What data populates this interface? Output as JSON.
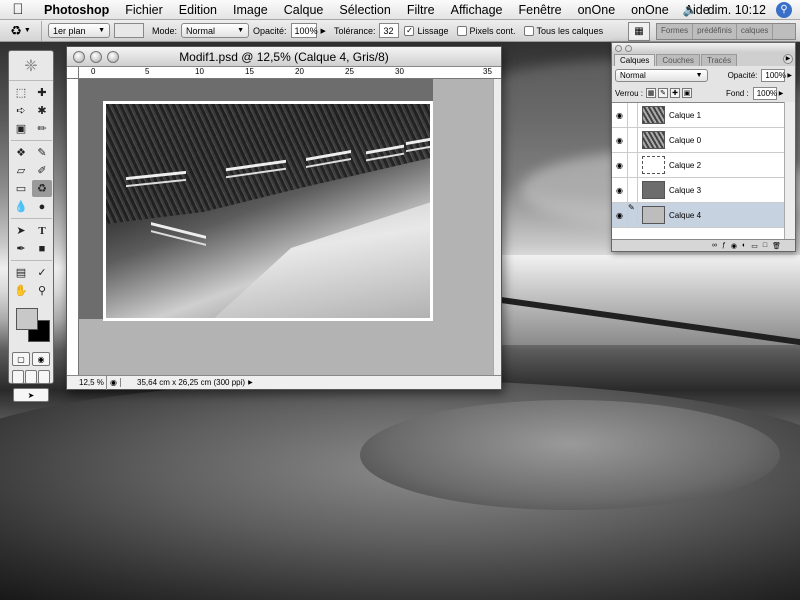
{
  "menubar": {
    "app_name": "Photoshop",
    "items": [
      "Fichier",
      "Edition",
      "Image",
      "Calque",
      "Sélection",
      "Filtre",
      "Affichage",
      "Fenêtre",
      "onOne",
      "onOne",
      "Aide"
    ],
    "clock": "dim. 10:12"
  },
  "options": {
    "mode_source": "1er plan",
    "mode_label": "Mode:",
    "mode_value": "Normal",
    "opacity_label": "Opacité:",
    "opacity_value": "100%",
    "tolerance_label": "Tolérance:",
    "tolerance_value": "32",
    "lissage_label": "Lissage",
    "pixels_label": "Pixels cont.",
    "all_layers_label": "Tous les calques",
    "well_tabs": [
      "Formes",
      "prédéfinis",
      "calques"
    ]
  },
  "document": {
    "title": "Modif1.psd @ 12,5% (Calque 4, Gris/8)",
    "ruler_labels": [
      "0",
      "5",
      "10",
      "15",
      "20",
      "25",
      "30",
      "35"
    ],
    "zoom": "12,5 %",
    "info": "35,64 cm x 26,25 cm (300 ppi)"
  },
  "layers_palette": {
    "tabs": [
      "Calques",
      "Couches",
      "Tracés"
    ],
    "blend_mode": "Normal",
    "opacity_label": "Opacité:",
    "opacity_value": "100%",
    "lock_label": "Verrou :",
    "fill_label": "Fond :",
    "fill_value": "100%",
    "layers": [
      {
        "name": "Calque 1",
        "selected": false
      },
      {
        "name": "Calque 0",
        "selected": false
      },
      {
        "name": "Calque 2",
        "selected": false
      },
      {
        "name": "Calque 3",
        "selected": false
      },
      {
        "name": "Calque 4",
        "selected": true
      }
    ]
  }
}
